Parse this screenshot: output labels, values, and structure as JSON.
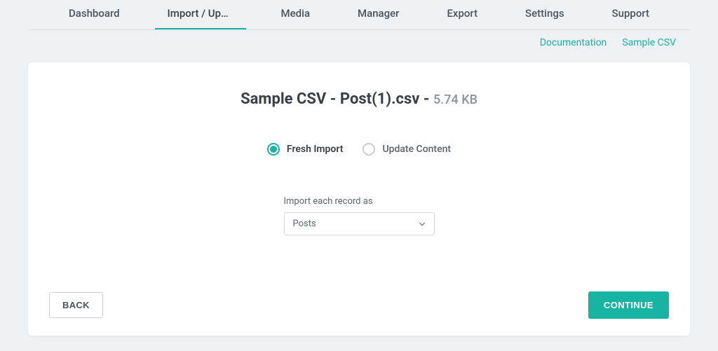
{
  "tabs": {
    "items": [
      {
        "label": "Dashboard"
      },
      {
        "label": "Import / Upd…"
      },
      {
        "label": "Media"
      },
      {
        "label": "Manager"
      },
      {
        "label": "Export"
      },
      {
        "label": "Settings"
      },
      {
        "label": "Support"
      }
    ],
    "activeIndex": 1
  },
  "sublinks": {
    "documentation": "Documentation",
    "sample_csv": "Sample CSV"
  },
  "file": {
    "name": "Sample CSV - Post(1).csv - ",
    "size": "5.74 KB"
  },
  "import_mode": {
    "fresh": "Fresh Import",
    "update": "Update Content",
    "selected": "fresh"
  },
  "record_select": {
    "label": "Import each record as",
    "value": "Posts"
  },
  "buttons": {
    "back": "BACK",
    "continue": "CONTINUE"
  }
}
